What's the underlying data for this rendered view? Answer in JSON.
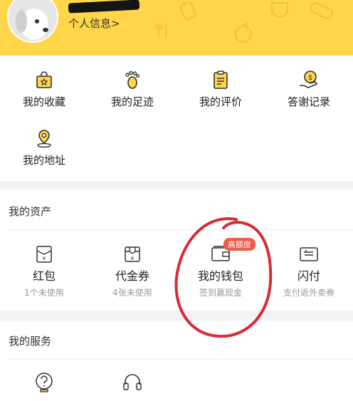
{
  "header": {
    "profile_link": "个人信息>",
    "colors": {
      "background": "#ffd54a",
      "username_mask": "#141414"
    }
  },
  "quick_links": [
    {
      "label": "我的收藏",
      "icon": "bag-star-icon"
    },
    {
      "label": "我的足迹",
      "icon": "footprint-icon"
    },
    {
      "label": "我的评价",
      "icon": "review-clipboard-icon"
    },
    {
      "label": "答谢记录",
      "icon": "hand-coin-icon"
    },
    {
      "label": "我的地址",
      "icon": "location-pin-icon"
    }
  ],
  "assets": {
    "title": "我的资产",
    "items": [
      {
        "label": "红包",
        "sub": "1个未使用",
        "icon": "red-envelope-icon"
      },
      {
        "label": "代金券",
        "sub": "4张未使用",
        "icon": "voucher-icon"
      },
      {
        "label": "我的钱包",
        "sub": "签到赢现金",
        "icon": "wallet-icon",
        "badge": "高额度"
      },
      {
        "label": "闪付",
        "sub": "支付返外卖券",
        "icon": "quick-pay-icon"
      }
    ]
  },
  "services": {
    "title": "我的服务",
    "items": [
      {
        "icon": "help-question-icon"
      },
      {
        "icon": "headset-icon"
      }
    ]
  },
  "annotation": {
    "color": "#d92b35",
    "shape": "hand-drawn circle around wallet"
  }
}
